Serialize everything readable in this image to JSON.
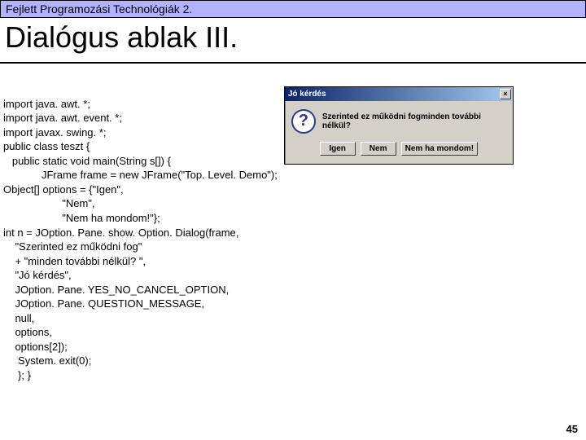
{
  "header": {
    "text": "Fejlett Programozási Technológiák 2."
  },
  "title": {
    "text": "Dialógus ablak III."
  },
  "code": {
    "lines": [
      "import java. awt. *;",
      "import java. awt. event. *;",
      "import javax. swing. *;",
      "public class teszt {",
      "   public static void main(String s[]) {",
      "             JFrame frame = new JFrame(\"Top. Level. Demo\");",
      "Object[] options = {\"Igen\",",
      "                    \"Nem\",",
      "                    \"Nem ha mondom!\"};",
      "int n = JOption. Pane. show. Option. Dialog(frame,",
      "    \"Szerinted ez működni fog\"",
      "    + \"minden további nélkül? \",",
      "    \"Jó kérdés\",",
      "    JOption. Pane. YES_NO_CANCEL_OPTION,",
      "    JOption. Pane. QUESTION_MESSAGE,",
      "    null,",
      "    options,",
      "    options[2]);",
      "     System. exit(0);",
      "     }; }"
    ]
  },
  "dialog": {
    "title": "Jó kérdés",
    "close_glyph": "×",
    "icon_glyph": "?",
    "message": "Szerinted ez működni fogminden további nélkül?",
    "buttons": {
      "yes": "Igen",
      "no": "Nem",
      "cancel": "Nem ha mondom!"
    }
  },
  "page": {
    "number": "45"
  }
}
